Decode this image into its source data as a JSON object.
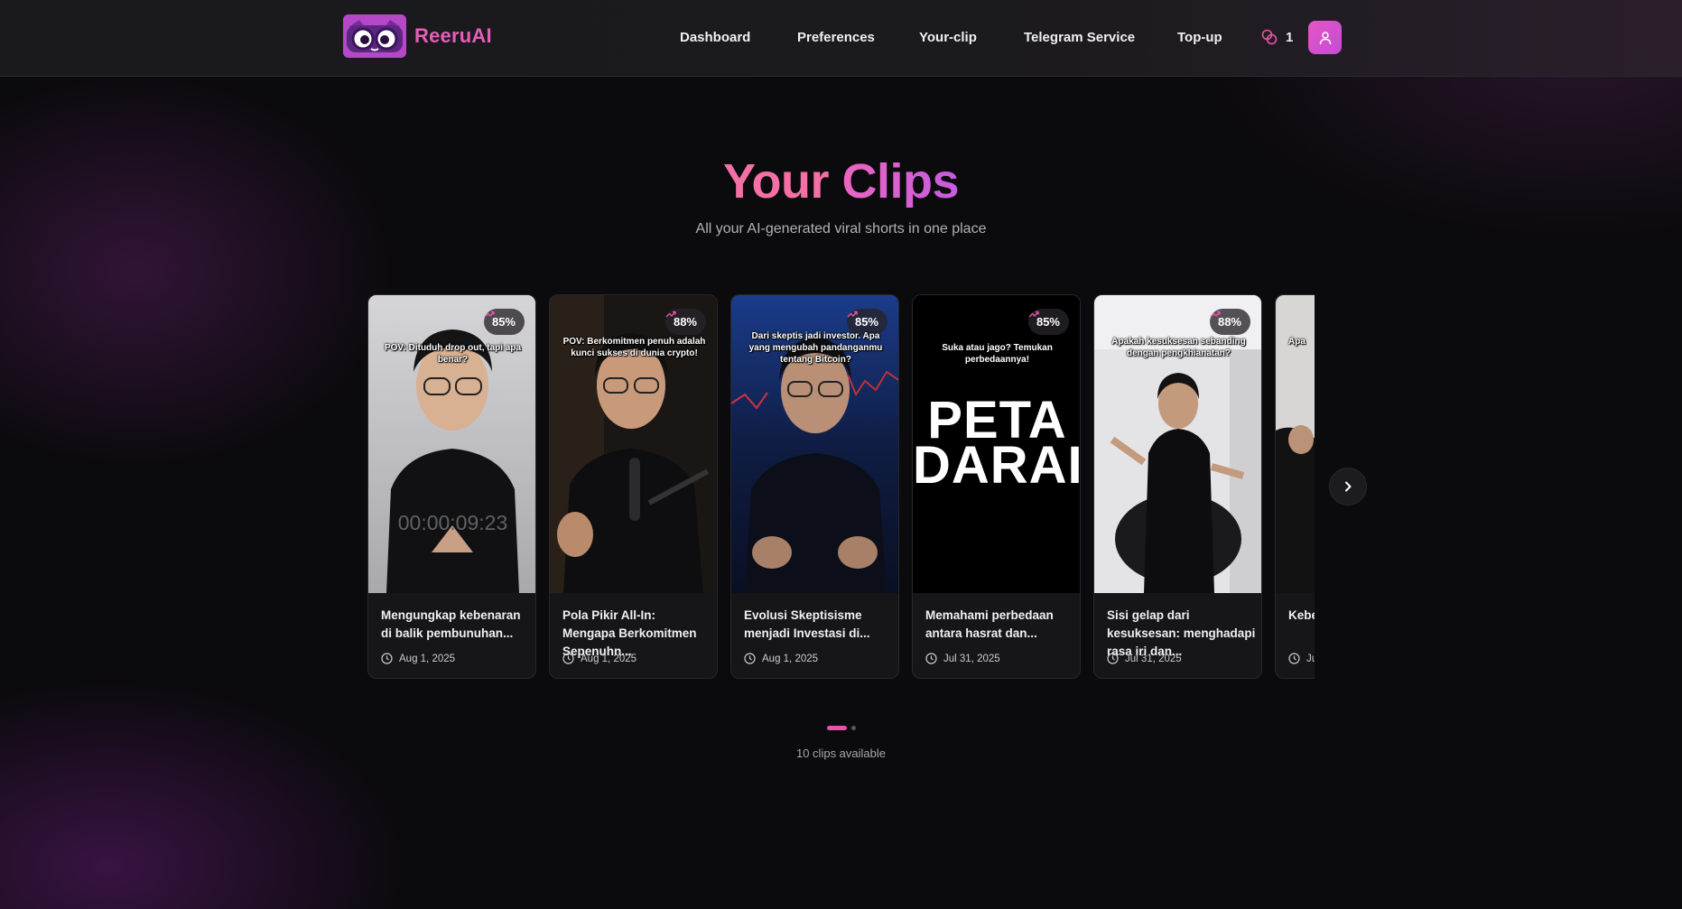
{
  "brand": {
    "name": "ReeruAI"
  },
  "nav": {
    "items": [
      {
        "label": "Dashboard"
      },
      {
        "label": "Preferences"
      },
      {
        "label": "Your-clip"
      },
      {
        "label": "Telegram Service"
      },
      {
        "label": "Top-up"
      }
    ]
  },
  "credits": {
    "count": "1",
    "icon": "coins-icon"
  },
  "user": {
    "icon": "user-icon"
  },
  "hero": {
    "title_part1": "Your",
    "title_part2": "Clips",
    "subtitle": "All your AI-generated viral shorts in one place"
  },
  "clips": [
    {
      "score": "85%",
      "caption": "POV: Dituduh drop out, tapi apa benar?",
      "timecode": "00:00:09:23",
      "title": "Mengungkap kebenaran di balik pembunuhan...",
      "date": "Aug 1, 2025"
    },
    {
      "score": "88%",
      "caption": "POV: Berkomitmen penuh adalah kunci sukses di dunia crypto!",
      "title": "Pola Pikir All-In: Mengapa Berkomitmen Sepenuhn...",
      "date": "Aug 1, 2025"
    },
    {
      "score": "85%",
      "caption": "Dari skeptis jadi investor. Apa yang mengubah pandanganmu tentang Bitcoin?",
      "title": "Evolusi Skeptisisme menjadi Investasi di...",
      "date": "Aug 1, 2025"
    },
    {
      "score": "85%",
      "caption": "Suka atau jago? Temukan perbedaannya!",
      "overlay_line1": "PETA",
      "overlay_line2": "DARAI",
      "title": "Memahami perbedaan antara hasrat dan...",
      "date": "Jul 31, 2025"
    },
    {
      "score": "88%",
      "caption": "Apakah kesuksesan sebanding dengan pengkhianatan?",
      "title": "Sisi gelap dari kesuksesan: menghadapi rasa iri dan...",
      "date": "Jul 31, 2025"
    },
    {
      "caption": "Apa",
      "title": "Kebe Meng",
      "date": "Ju"
    }
  ],
  "pagination": {
    "count_text": "10 clips available"
  },
  "colors": {
    "accent": "#e754a6",
    "brand": "#e45fb8",
    "title_pink": "#f46fa6",
    "background": "#0b0a0d"
  }
}
